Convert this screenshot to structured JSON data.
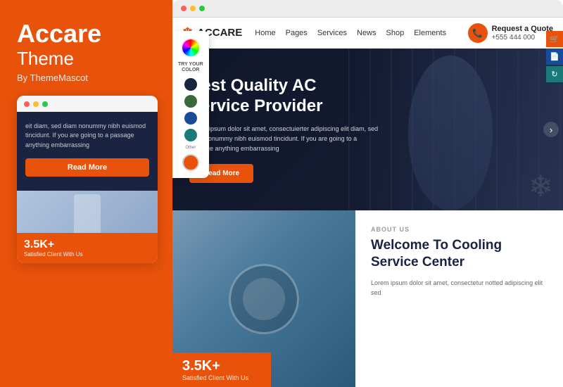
{
  "left": {
    "brand_name": "Accare",
    "brand_sub": "Theme",
    "by_text": "By ThemeMascot",
    "mobile_card": {
      "body_text": "eit diam, sed diam nonummy nibh euismod tincidunt. If you are going to a passage anything embarrassing",
      "read_more_label": "Read More",
      "stats_number": "3.5K+",
      "stats_label": "Satisfied Client With Us"
    }
  },
  "right": {
    "browser_dots": [
      "red",
      "yellow",
      "green"
    ],
    "nav": {
      "logo_text": "ACCARE",
      "logo_icon": "❄",
      "links": [
        "Home",
        "Pages",
        "Services",
        "News",
        "Shop",
        "Elements"
      ],
      "cta_label": "Request a Quote",
      "cta_phone": "+555 444 000"
    },
    "hero": {
      "title": "Best Quality AC Service Provider",
      "body_text": "Lorem ipsum dolor sit amet, consectuierter adipiscing elit diam, sed diam nonummy nibh euismod tincidunt. If you are going to a passage anything embarrassing",
      "read_more_label": "Read More",
      "prev_icon": "‹",
      "next_icon": "›"
    },
    "color_picker": {
      "title": "TRY YOUR\nCOLOR",
      "other_label": "Other",
      "swatches": [
        "#1a2340",
        "#3a6a3a",
        "#1a4a9a",
        "#1a7a7a",
        "#e8520a"
      ]
    },
    "bottom": {
      "about_label": "ABOUT US",
      "about_title": "Welcome To Cooling Service Center",
      "about_text": "Lorem ipsum dolor sit amet, consectetur notted adipiscing elit sed",
      "stats_number": "3.5K+",
      "stats_label": "Satisfied Client With Us"
    }
  }
}
